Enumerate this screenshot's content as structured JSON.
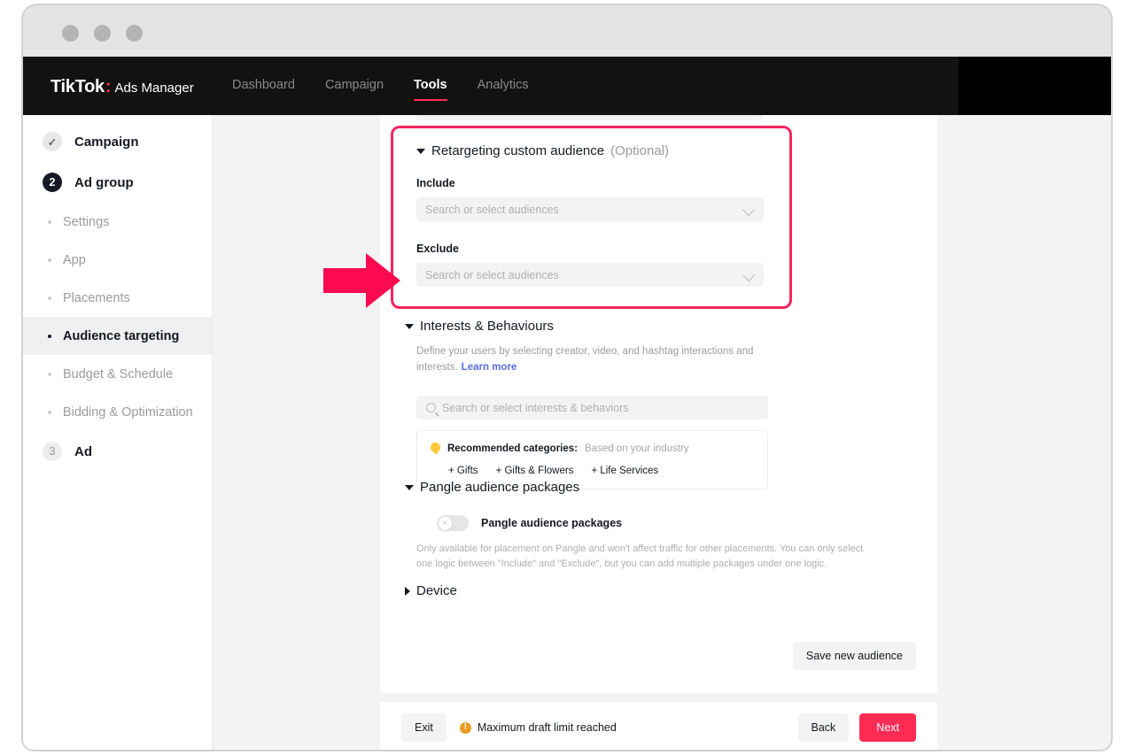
{
  "topnav": {
    "brand_name": "TikTok",
    "brand_colon": ":",
    "brand_sub": "Ads Manager",
    "items": [
      {
        "label": "Dashboard",
        "active": false
      },
      {
        "label": "Campaign",
        "active": false
      },
      {
        "label": "Tools",
        "active": true
      },
      {
        "label": "Analytics",
        "active": false
      }
    ]
  },
  "sidebar": {
    "steps": [
      {
        "badge": "✓",
        "label": "Campaign",
        "state": "done"
      },
      {
        "badge": "2",
        "label": "Ad group",
        "state": "current"
      },
      {
        "badge": "3",
        "label": "Ad",
        "state": "future"
      }
    ],
    "subitems": [
      {
        "label": "Settings",
        "active": false
      },
      {
        "label": "App",
        "active": false
      },
      {
        "label": "Placements",
        "active": false
      },
      {
        "label": "Audience targeting",
        "active": true
      },
      {
        "label": "Budget & Schedule",
        "active": false
      },
      {
        "label": "Bidding & Optimization",
        "active": false
      }
    ]
  },
  "retargeting": {
    "title": "Retargeting custom audience",
    "optional": "(Optional)",
    "include_label": "Include",
    "include_placeholder": "Search or select audiences",
    "exclude_label": "Exclude",
    "exclude_placeholder": "Search or select audiences"
  },
  "interests": {
    "title": "Interests & Behaviours",
    "description": "Define your users by selecting creator, video, and hashtag interactions and interests.",
    "learn_more": "Learn more",
    "search_placeholder": "Search or select interests & behaviors",
    "recommended_label": "Recommended categories:",
    "recommended_sub": "Based on your industry",
    "chips": [
      "+ Gifts",
      "+ Gifts & Flowers",
      "+ Life Services"
    ]
  },
  "pangle": {
    "title": "Pangle audience packages",
    "toggle_label": "Pangle audience packages",
    "toggle_state": "off",
    "toggle_knob_glyph": "✕",
    "note": "Only available for placement on Pangle and won't affect traffic for other placements. You can only select one logic between \"Include\" and \"Exclude\", but you can add multiple packages under one logic."
  },
  "device": {
    "title": "Device"
  },
  "actions": {
    "save_new_audience": "Save new audience"
  },
  "footer": {
    "exit": "Exit",
    "warning": "Maximum draft limit reached",
    "back": "Back",
    "next": "Next"
  },
  "colors": {
    "accent_pink": "#fe2c55",
    "highlight_pink": "#f4265e",
    "link_blue": "#5a6ce0",
    "warning_orange": "#eb9b1f",
    "bulb_yellow": "#ffc73a"
  }
}
